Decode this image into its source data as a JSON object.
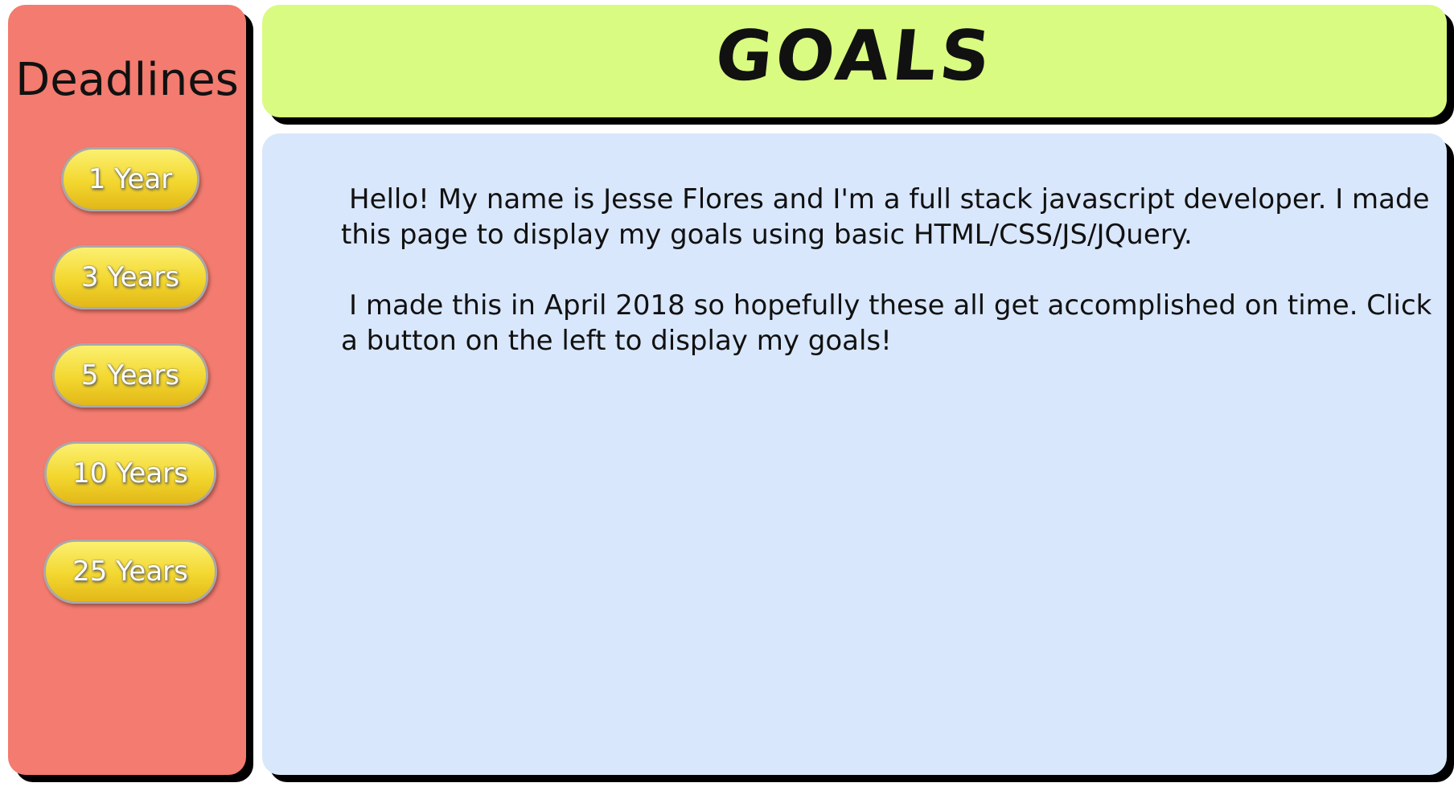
{
  "sidebar": {
    "title": "Deadlines",
    "buttons": [
      {
        "label": "1 Year"
      },
      {
        "label": "3 Years"
      },
      {
        "label": "5 Years"
      },
      {
        "label": "10 Years"
      },
      {
        "label": "25 Years"
      }
    ]
  },
  "header": {
    "title": "GOALS"
  },
  "content": {
    "paragraphs": [
      "Hello! My name is Jesse Flores and I'm a full stack javascript developer. I made this page to display my goals using basic HTML/CSS/JS/JQuery.",
      "I made this in April 2018 so hopefully these all get accomplished on time. Click a button on the left to display my goals!"
    ]
  },
  "colors": {
    "sidebar_bg": "#f37b6f",
    "header_bg": "#d9fb82",
    "content_bg": "#d9e7fc",
    "button_gold": "#f3d72f",
    "shadow": "#000000"
  }
}
